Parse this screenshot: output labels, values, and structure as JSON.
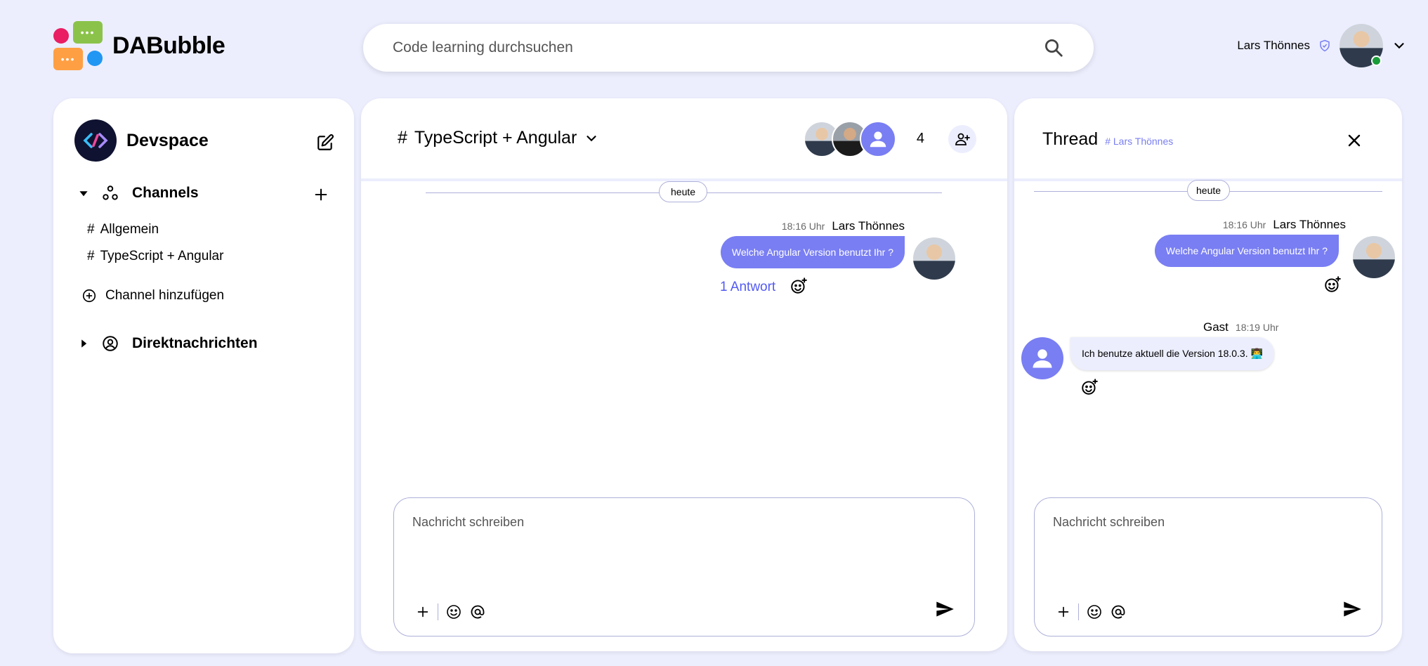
{
  "app": {
    "logo_text": "DABubble"
  },
  "search": {
    "placeholder": "Code learning durchsuchen"
  },
  "user": {
    "name": "Lars Thönnes"
  },
  "sidebar": {
    "workspace": "Devspace",
    "channels_label": "Channels",
    "channels": [
      {
        "hash": "#",
        "name": "Allgemein"
      },
      {
        "hash": "#",
        "name": "TypeScript + Angular"
      }
    ],
    "add_channel_label": "Channel hinzufügen",
    "dm_label": "Direktnachrichten"
  },
  "channel": {
    "title": "TypeScript + Angular",
    "member_count": "4",
    "day_label": "heute",
    "message": {
      "time": "18:16 Uhr",
      "author": "Lars Thönnes",
      "text": "Welche Angular Version benutzt Ihr ?",
      "reply_link": "1 Antwort"
    },
    "composer_placeholder": "Nachricht schreiben"
  },
  "thread": {
    "title": "Thread",
    "channel_ref": "# Lars Thönnes",
    "day_label": "heute",
    "messages": [
      {
        "time": "18:16 Uhr",
        "author": "Lars Thönnes",
        "text": "Welche Angular Version benutzt Ihr ?"
      },
      {
        "time": "18:19 Uhr",
        "author": "Gast",
        "text": "Ich benutze aktuell die Version 18.0.3. 👨‍💻"
      }
    ],
    "composer_placeholder": "Nachricht schreiben"
  },
  "colors": {
    "background": "#eceefe",
    "accent": "#797ef3",
    "link": "#535af1",
    "online": "#1a9c3a"
  }
}
